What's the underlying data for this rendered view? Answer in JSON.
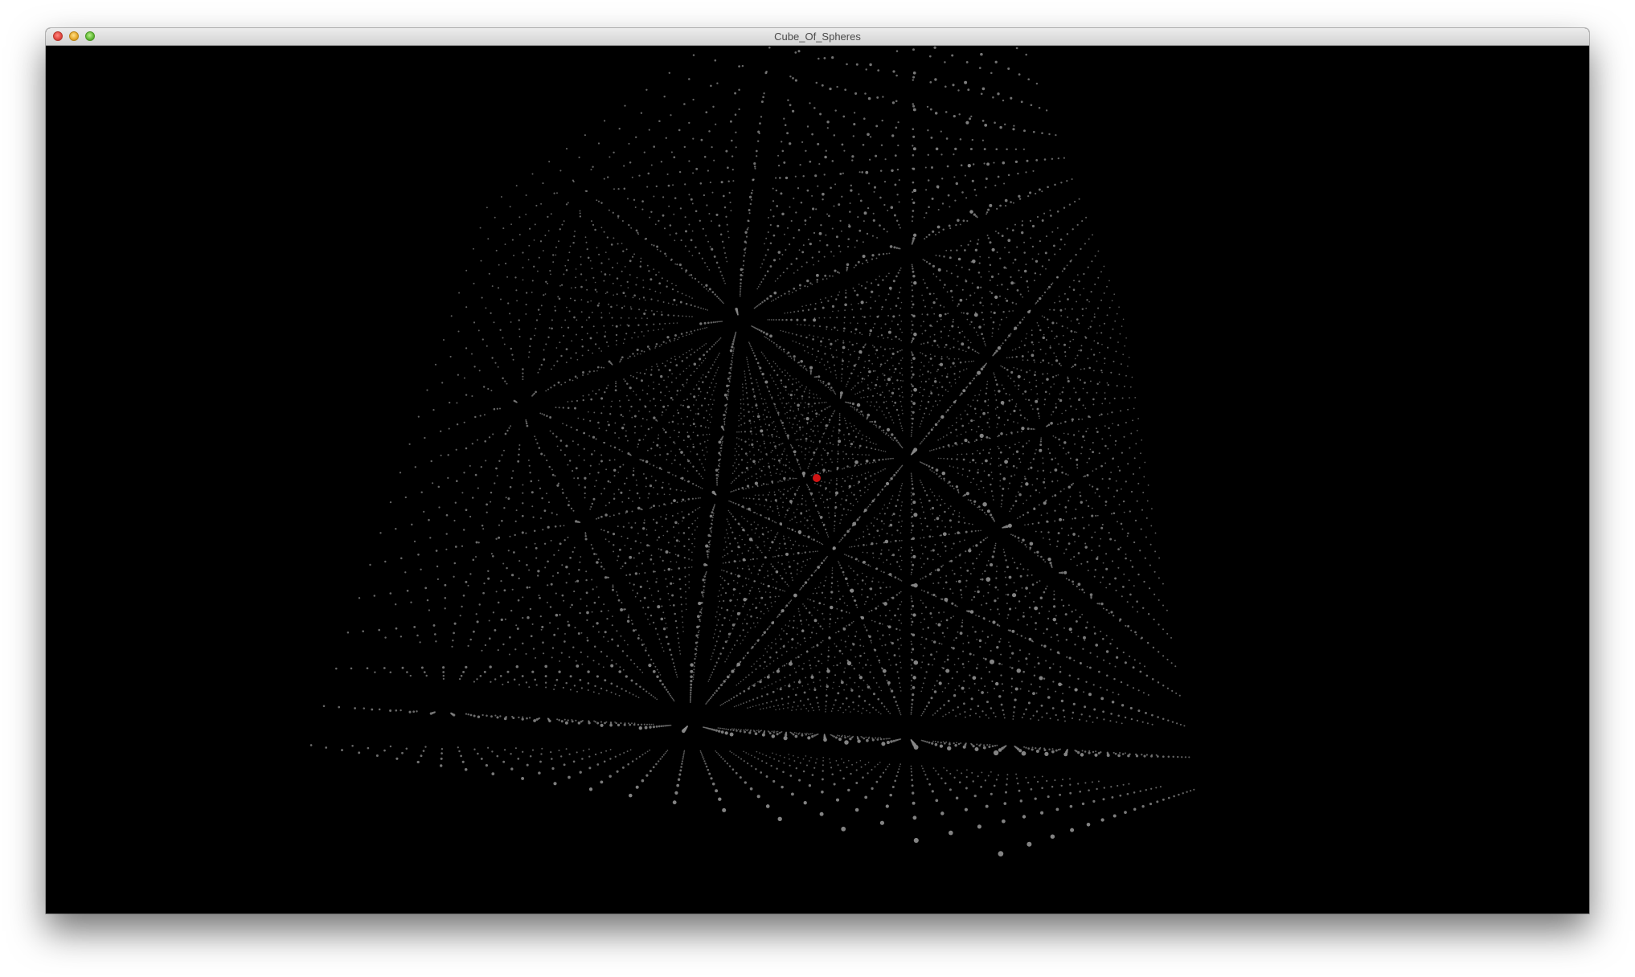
{
  "window": {
    "title": "Cube_Of_Spheres",
    "buttons": {
      "close": "close",
      "minimize": "minimize",
      "zoom": "zoom"
    }
  },
  "scene": {
    "background": "#000000",
    "sphere_color": "#8a8a8a",
    "highlight_color": "#d01414"
  }
}
